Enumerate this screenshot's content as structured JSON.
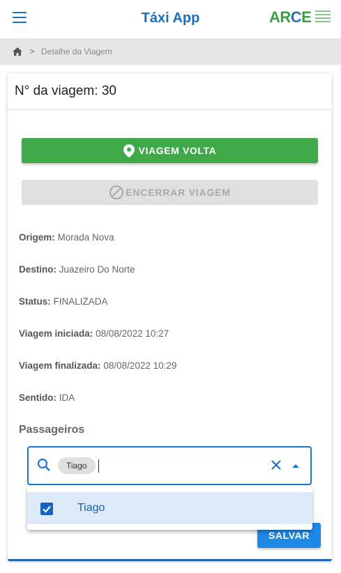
{
  "header": {
    "title": "Táxi App",
    "logo_text": {
      "ar": "AR",
      "c": "C",
      "e": "E"
    }
  },
  "breadcrumb": {
    "separator": ">",
    "current": "Detalhe da Viagem"
  },
  "card": {
    "title": "N° da viagem: 30",
    "btn_volta": "VIAGEM VOLTA",
    "btn_encerrar": "ENCERRAR VIAGEM",
    "info": [
      {
        "label": "Origem:",
        "value": "Morada Nova"
      },
      {
        "label": "Destino:",
        "value": "Juazeiro Do Norte"
      },
      {
        "label": "Status:",
        "value": "FINALIZADA"
      },
      {
        "label": "Viagem iniciada:",
        "value": "08/08/2022 10:27"
      },
      {
        "label": "Viagem finalizada:",
        "value": "08/08/2022 10:29"
      },
      {
        "label": "Sentido:",
        "value": "IDA"
      }
    ],
    "passageiros_title": "Passageiros",
    "selected_chip": "Tiago",
    "search_value": "",
    "btn_salvar": "SALVAR"
  },
  "dropdown": {
    "options": [
      {
        "label": "Tiago",
        "checked": true
      }
    ]
  },
  "colors": {
    "primary": "#1976d2",
    "green": "#3fa94a",
    "disabled": "#e0e0e0"
  }
}
